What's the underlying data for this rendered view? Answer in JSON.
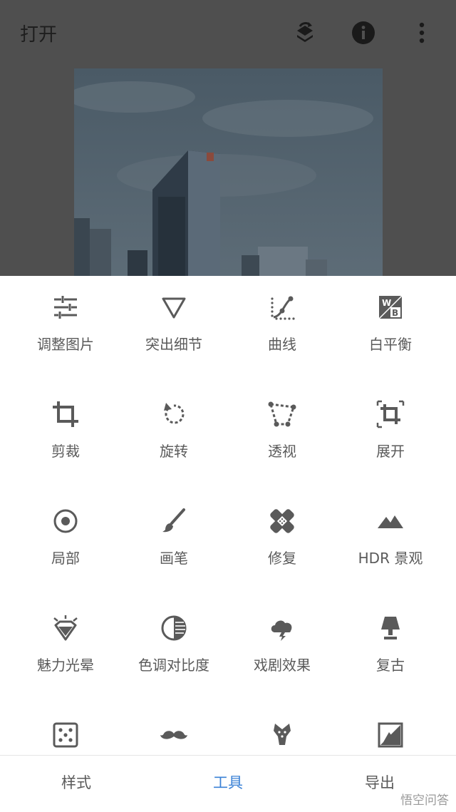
{
  "header": {
    "title": "打开"
  },
  "tools": [
    {
      "label": "调整图片",
      "icon": "sliders-icon"
    },
    {
      "label": "突出细节",
      "icon": "triangle-down-icon"
    },
    {
      "label": "曲线",
      "icon": "curves-icon"
    },
    {
      "label": "白平衡",
      "icon": "white-balance-icon"
    },
    {
      "label": "剪裁",
      "icon": "crop-icon"
    },
    {
      "label": "旋转",
      "icon": "rotate-icon"
    },
    {
      "label": "透视",
      "icon": "perspective-icon"
    },
    {
      "label": "展开",
      "icon": "expand-icon"
    },
    {
      "label": "局部",
      "icon": "selective-icon"
    },
    {
      "label": "画笔",
      "icon": "brush-icon"
    },
    {
      "label": "修复",
      "icon": "healing-icon"
    },
    {
      "label": "HDR 景观",
      "icon": "hdr-mountain-icon"
    },
    {
      "label": "魅力光晕",
      "icon": "glamour-glow-icon"
    },
    {
      "label": "色调对比度",
      "icon": "tonal-contrast-icon"
    },
    {
      "label": "戏剧效果",
      "icon": "drama-cloud-icon"
    },
    {
      "label": "复古",
      "icon": "vintage-lamp-icon"
    },
    {
      "label": "",
      "icon": "grainy-film-icon"
    },
    {
      "label": "",
      "icon": "mustache-icon"
    },
    {
      "label": "",
      "icon": "grunge-guitar-icon"
    },
    {
      "label": "",
      "icon": "black-white-icon"
    }
  ],
  "tabs": [
    {
      "label": "样式"
    },
    {
      "label": "工具"
    },
    {
      "label": "导出"
    }
  ],
  "watermark": "悟空问答",
  "colors": {
    "accent": "#3b82d6",
    "icon": "#5a5a5a"
  }
}
